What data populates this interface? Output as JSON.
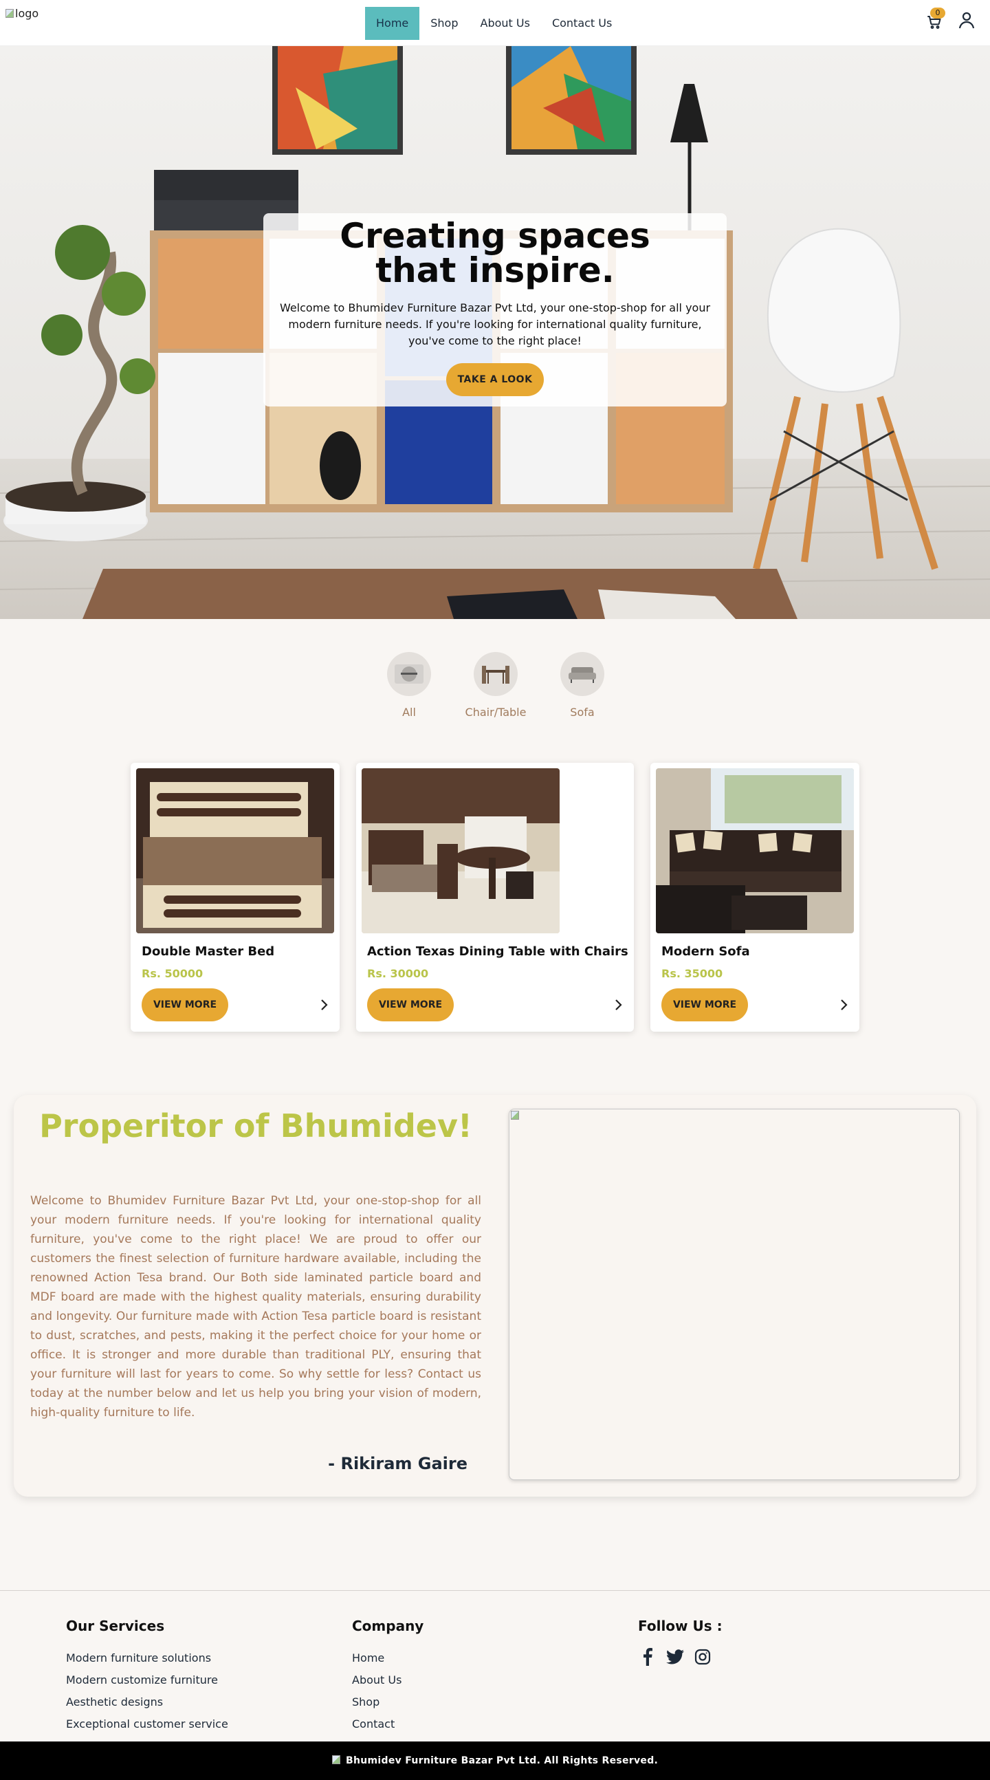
{
  "header": {
    "logo_alt": "logo",
    "nav": [
      {
        "label": "Home",
        "active": true
      },
      {
        "label": "Shop",
        "active": false
      },
      {
        "label": "About Us",
        "active": false
      },
      {
        "label": "Contact Us",
        "active": false
      }
    ],
    "cart_count": "0",
    "icons": {
      "cart": "cart-icon",
      "user": "user-icon"
    }
  },
  "hero": {
    "title": "Creating spaces that inspire.",
    "text": "Welcome to Bhumidev Furniture Bazar Pvt Ltd, your one-stop-shop for all your modern furniture needs. If you're looking for international quality furniture, you've come to the right place!",
    "button": "TAKE A LOOK"
  },
  "categories": [
    {
      "label": "All",
      "icon": "all-icon"
    },
    {
      "label": "Chair/Table",
      "icon": "chair-table-icon"
    },
    {
      "label": "Sofa",
      "icon": "sofa-icon"
    }
  ],
  "products": [
    {
      "name": "Double Master Bed",
      "price": "Rs. 50000",
      "button": "VIEW MORE"
    },
    {
      "name": "Action Texas Dining Table with Chairs",
      "price": "Rs. 30000",
      "button": "VIEW MORE"
    },
    {
      "name": "Modern Sofa",
      "price": "Rs. 35000",
      "button": "VIEW MORE"
    }
  ],
  "about": {
    "title": "Properitor of Bhumidev!",
    "text": "Welcome to Bhumidev Furniture Bazar Pvt Ltd, your one-stop-shop for all your modern furniture needs. If you're looking for international quality furniture, you've come to the right place! We are proud to offer our customers the finest selection of furniture hardware available, including the renowned Action Tesa brand. Our Both side laminated particle board and MDF board are made with the highest quality materials, ensuring durability and longevity. Our furniture made with Action Tesa particle board is resistant to dust, scratches, and pests, making it the perfect choice for your home or office. It is stronger and more durable than traditional PLY, ensuring that your furniture will last for years to come. So why settle for less? Contact us today at the number below and let us help you bring your vision of modern, high-quality furniture to life.",
    "signature": "- Rikiram Gaire"
  },
  "footer": {
    "services": {
      "heading": "Our Services",
      "items": [
        "Modern furniture solutions",
        "Modern customize furniture",
        "Aesthetic designs",
        "Exceptional customer service"
      ]
    },
    "company": {
      "heading": "Company",
      "items": [
        "Home",
        "About Us",
        "Shop",
        "Contact"
      ]
    },
    "follow": {
      "heading": "Follow Us :",
      "icons": [
        "facebook-icon",
        "twitter-icon",
        "instagram-icon"
      ]
    },
    "copyright": "Bhumidev Furniture Bazar Pvt Ltd. All Rights Reserved."
  },
  "colors": {
    "accent": "#e7a832",
    "nav_active": "#5bbcbd",
    "price": "#b9c44a",
    "about_title": "#bcc548",
    "about_text": "#a5785a"
  }
}
